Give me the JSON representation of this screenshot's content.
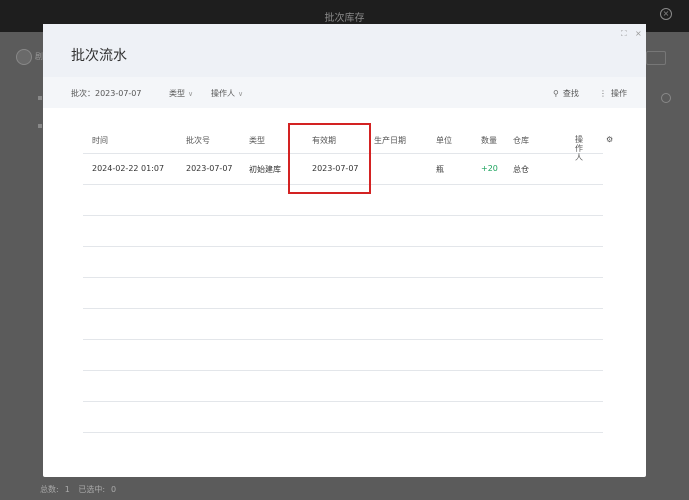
{
  "background": {
    "window_title": "批次库存",
    "refresh_label": "剧",
    "footer": {
      "total_label": "总数:",
      "total_value": "1",
      "selected_label": "已选中:",
      "selected_value": "0"
    }
  },
  "modal": {
    "title": "批次流水",
    "controls": {
      "maximize": "⛶",
      "close": "×"
    },
    "toolbar": {
      "batch_filter": "批次：2023-07-07",
      "type_filter": "类型",
      "operator_filter": "操作人",
      "search_label": "查找",
      "action_label": "操作"
    },
    "table": {
      "columns": [
        "时间",
        "批次号",
        "类型",
        "有效期",
        "生产日期",
        "单位",
        "数量",
        "仓库",
        "操作人"
      ],
      "rows": [
        {
          "time": "2024-02-22 01:07",
          "batch": "2023-07-07",
          "type": "初始建库",
          "expiry": "2023-07-07",
          "production": "",
          "unit": "瓶",
          "quantity": "+20",
          "warehouse": "总仓",
          "operator": ""
        }
      ],
      "empty_rows": 8
    }
  },
  "colors": {
    "highlight": "#d32222",
    "quantity_positive": "#1aa35c"
  }
}
